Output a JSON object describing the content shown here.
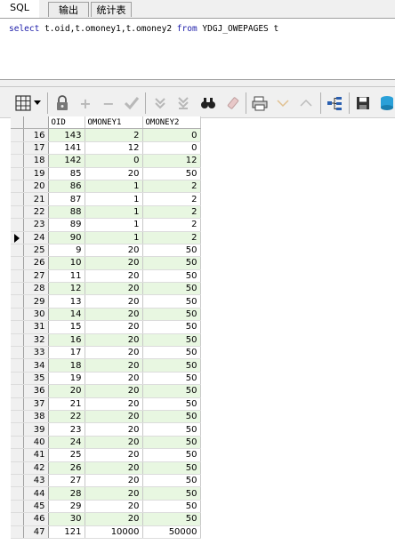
{
  "tabs": [
    {
      "label": "SQL"
    },
    {
      "label": "输出"
    },
    {
      "label": "统计表"
    }
  ],
  "sql": {
    "kw_select": "select",
    "columns": "t.oid,t.omoney1,t.omoney2",
    "kw_from": "from",
    "table": "YDGJ_OWEPAGES t"
  },
  "toolbar": {
    "icons": [
      "grid-icon",
      "dropdown-icon",
      "lock-icon",
      "add-icon",
      "remove-icon",
      "check-icon",
      "next-record-icon",
      "last-record-icon",
      "find-icon",
      "clear-icon",
      "print-icon",
      "filter-down-icon",
      "filter-up-icon",
      "tree-icon",
      "save-icon",
      "database-icon"
    ]
  },
  "grid": {
    "columns": [
      "OID",
      "OMONEY1",
      "OMONEY2"
    ],
    "current_row": "24",
    "rows": [
      {
        "rn": "16",
        "oid": "143",
        "m1": "2",
        "m2": "0"
      },
      {
        "rn": "17",
        "oid": "141",
        "m1": "12",
        "m2": "0"
      },
      {
        "rn": "18",
        "oid": "142",
        "m1": "0",
        "m2": "12"
      },
      {
        "rn": "19",
        "oid": "85",
        "m1": "20",
        "m2": "50"
      },
      {
        "rn": "20",
        "oid": "86",
        "m1": "1",
        "m2": "2"
      },
      {
        "rn": "21",
        "oid": "87",
        "m1": "1",
        "m2": "2"
      },
      {
        "rn": "22",
        "oid": "88",
        "m1": "1",
        "m2": "2"
      },
      {
        "rn": "23",
        "oid": "89",
        "m1": "1",
        "m2": "2"
      },
      {
        "rn": "24",
        "oid": "90",
        "m1": "1",
        "m2": "2"
      },
      {
        "rn": "25",
        "oid": "9",
        "m1": "20",
        "m2": "50"
      },
      {
        "rn": "26",
        "oid": "10",
        "m1": "20",
        "m2": "50"
      },
      {
        "rn": "27",
        "oid": "11",
        "m1": "20",
        "m2": "50"
      },
      {
        "rn": "28",
        "oid": "12",
        "m1": "20",
        "m2": "50"
      },
      {
        "rn": "29",
        "oid": "13",
        "m1": "20",
        "m2": "50"
      },
      {
        "rn": "30",
        "oid": "14",
        "m1": "20",
        "m2": "50"
      },
      {
        "rn": "31",
        "oid": "15",
        "m1": "20",
        "m2": "50"
      },
      {
        "rn": "32",
        "oid": "16",
        "m1": "20",
        "m2": "50"
      },
      {
        "rn": "33",
        "oid": "17",
        "m1": "20",
        "m2": "50"
      },
      {
        "rn": "34",
        "oid": "18",
        "m1": "20",
        "m2": "50"
      },
      {
        "rn": "35",
        "oid": "19",
        "m1": "20",
        "m2": "50"
      },
      {
        "rn": "36",
        "oid": "20",
        "m1": "20",
        "m2": "50"
      },
      {
        "rn": "37",
        "oid": "21",
        "m1": "20",
        "m2": "50"
      },
      {
        "rn": "38",
        "oid": "22",
        "m1": "20",
        "m2": "50"
      },
      {
        "rn": "39",
        "oid": "23",
        "m1": "20",
        "m2": "50"
      },
      {
        "rn": "40",
        "oid": "24",
        "m1": "20",
        "m2": "50"
      },
      {
        "rn": "41",
        "oid": "25",
        "m1": "20",
        "m2": "50"
      },
      {
        "rn": "42",
        "oid": "26",
        "m1": "20",
        "m2": "50"
      },
      {
        "rn": "43",
        "oid": "27",
        "m1": "20",
        "m2": "50"
      },
      {
        "rn": "44",
        "oid": "28",
        "m1": "20",
        "m2": "50"
      },
      {
        "rn": "45",
        "oid": "29",
        "m1": "20",
        "m2": "50"
      },
      {
        "rn": "46",
        "oid": "30",
        "m1": "20",
        "m2": "50"
      },
      {
        "rn": "47",
        "oid": "121",
        "m1": "10000",
        "m2": "50000"
      }
    ]
  }
}
